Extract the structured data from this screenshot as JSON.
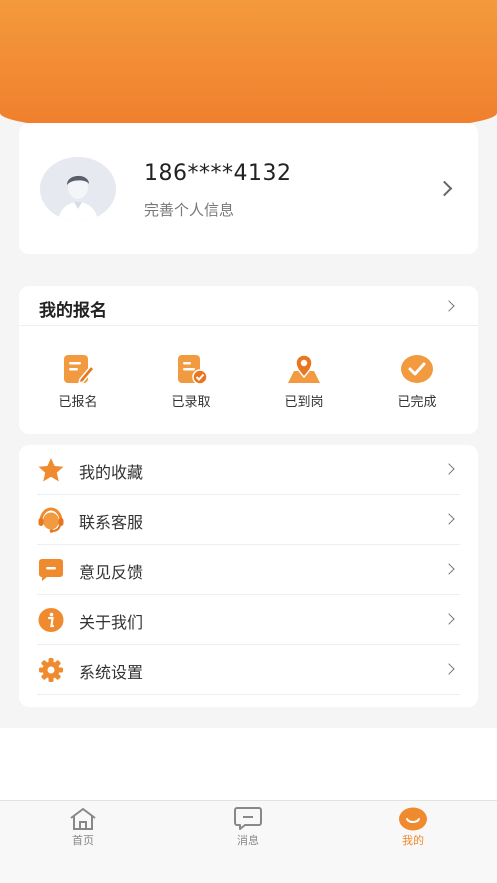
{
  "profile": {
    "phone": "186****4132",
    "subtitle": "完善个人信息"
  },
  "signup": {
    "title": "我的报名",
    "statuses": [
      {
        "label": "已报名",
        "icon": "edit-form-icon"
      },
      {
        "label": "已录取",
        "icon": "document-check-icon"
      },
      {
        "label": "已到岗",
        "icon": "location-pin-icon"
      },
      {
        "label": "已完成",
        "icon": "check-circle-icon"
      }
    ]
  },
  "menu": [
    {
      "label": "我的收藏",
      "icon": "star-icon"
    },
    {
      "label": "联系客服",
      "icon": "headset-icon"
    },
    {
      "label": "意见反馈",
      "icon": "message-icon"
    },
    {
      "label": "关于我们",
      "icon": "info-icon"
    },
    {
      "label": "系统设置",
      "icon": "gear-icon"
    }
  ],
  "tabs": [
    {
      "label": "首页",
      "icon": "home-icon",
      "active": false
    },
    {
      "label": "消息",
      "icon": "chat-icon",
      "active": false
    },
    {
      "label": "我的",
      "icon": "smile-icon",
      "active": true
    }
  ],
  "colors": {
    "accent": "#f08a2e",
    "header_top": "#f39a3c",
    "header_bottom": "#f07d2c"
  }
}
